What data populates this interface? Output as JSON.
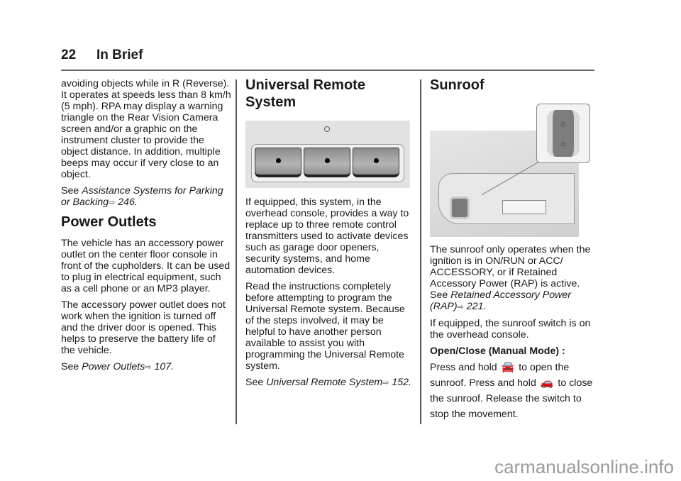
{
  "header": {
    "page_number": "22",
    "section": "In Brief"
  },
  "col1": {
    "para1": "avoiding objects while in R (Reverse). It operates at speeds less than 8 km/h (5 mph). RPA may display a warning triangle on the Rear Vision Camera screen and/or a graphic on the instrument cluster to provide the object distance. In addition, multiple beeps may occur if very close to an object.",
    "see1_prefix": "See ",
    "see1_link": "Assistance Systems for Parking or Backing",
    "see1_page": " 246.",
    "heading": "Power Outlets",
    "para2": "The vehicle has an accessory power outlet on the center floor console in front of the cupholders. It can be used to plug in electrical equipment, such as a cell phone or an MP3 player.",
    "para3": "The accessory power outlet does not work when the ignition is turned off and the driver door is opened. This helps to preserve the battery life of the vehicle.",
    "see2_prefix": "See ",
    "see2_link": "Power Outlets",
    "see2_page": " 107."
  },
  "col2": {
    "heading": "Universal Remote System",
    "para1": "If equipped, this system, in the overhead console, provides a way to replace up to three remote control transmitters used to activate devices such as garage door openers, security systems, and home automation devices.",
    "para2": "Read the instructions completely before attempting to program the Universal Remote system. Because of the steps involved, it may be helpful to have another person available to assist you with programming the Universal Remote system.",
    "see_prefix": "See ",
    "see_link": "Universal Remote System",
    "see_page": " 152."
  },
  "col3": {
    "heading": "Sunroof",
    "para1_main": "The sunroof only operates when the ignition is in ON/RUN or ACC/ ACCESSORY, or if Retained Accessory Power (RAP) is active.",
    "see_prefix": "See ",
    "see_link": "Retained Accessory Power (RAP)",
    "see_page": " 221.",
    "para2": "If equipped, the sunroof switch is on the overhead console.",
    "subheading": "Open/Close (Manual Mode) :",
    "instr_a": "Press and hold ",
    "instr_b": " to open the sunroof. Press and hold ",
    "instr_c": " to close the sunroof. Release the switch to stop the movement."
  },
  "icons": {
    "reference_arrow": "⇨",
    "sunroof_open": "🚘",
    "sunroof_close": "🚗"
  },
  "watermark": "carmanualsonline.info"
}
